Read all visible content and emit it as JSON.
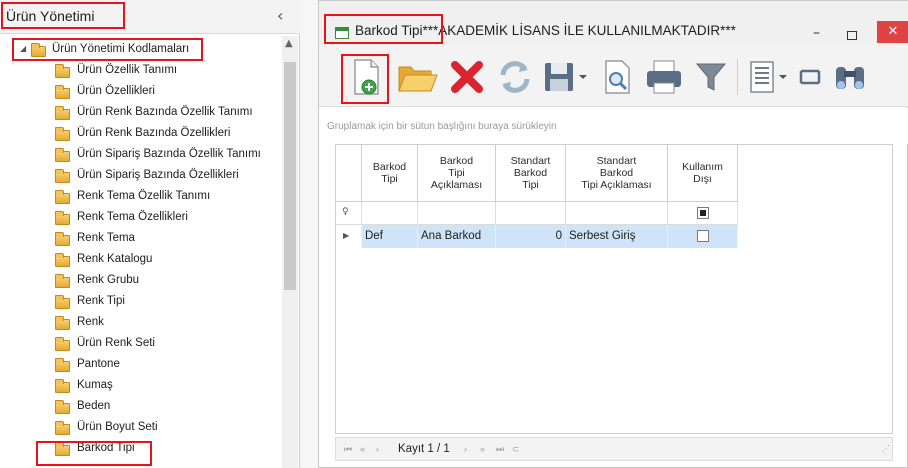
{
  "left_panel": {
    "title": "Ürün Yönetimi",
    "collapse_icon": "‹",
    "tree_root": "Ürün Yönetimi Kodlamaları",
    "tree_items": [
      "Ürün Özellik Tanımı",
      "Ürün Özellikleri",
      "Ürün Renk Bazında Özellik Tanımı",
      "Ürün Renk Bazında Özellikleri",
      "Ürün Sipariş Bazında Özellik Tanımı",
      "Ürün Sipariş Bazında Özellikleri",
      "Renk Tema Özellik Tanımı",
      "Renk Tema Özellikleri",
      "Renk Tema",
      "Renk Katalogu",
      "Renk Grubu",
      "Renk Tipi",
      "Renk",
      "Ürün Renk Seti",
      "Pantone",
      "Kumaş",
      "Beden",
      "Ürün Boyut Seti",
      "Barkod Tipi"
    ]
  },
  "window": {
    "title": "Barkod Tipi***AKADEMİK LİSANS İLE KULLANILMAKTADIR***",
    "min_glyph": "–",
    "close_glyph": "✕"
  },
  "toolbar": {
    "icons": [
      "new-document-icon",
      "open-folder-icon",
      "delete-icon",
      "refresh-icon",
      "save-icon",
      "print-preview-icon",
      "print-icon",
      "filter-icon",
      "layout-icon",
      "column-chooser-icon",
      "find-icon"
    ]
  },
  "grid": {
    "group_hint": "Gruplamak için bir sütun başlığını buraya sürükleyin",
    "columns": [
      [
        "Barkod",
        "Tipi"
      ],
      [
        "Barkod",
        "Tipi",
        "Açıklaması"
      ],
      [
        "Standart",
        "Barkod",
        "Tipi"
      ],
      [
        "Standart",
        "Barkod",
        "Tipi Açıklaması"
      ],
      [
        "Kullanım",
        "Dışı"
      ]
    ],
    "rows": [
      {
        "code": "Def",
        "desc": "Ana Barkod",
        "std_type": "0",
        "std_desc": "Serbest Giriş",
        "inactive": false
      }
    ],
    "filter_inactive_checked": true
  },
  "navigator": {
    "record_text": "Kayıt 1 / 1"
  },
  "colors": {
    "highlight": "#e8141c",
    "selected_row": "#cfe5f7",
    "close_button": "#e04343"
  }
}
